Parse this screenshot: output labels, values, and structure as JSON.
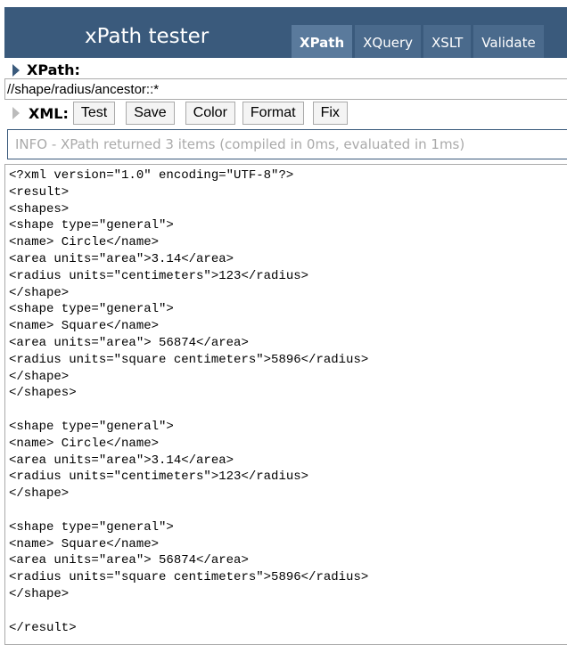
{
  "header": {
    "title": "xPath tester",
    "tabs": [
      {
        "label": "XPath",
        "active": true
      },
      {
        "label": "XQuery"
      },
      {
        "label": "XSLT"
      },
      {
        "label": "Validate"
      }
    ]
  },
  "xpath": {
    "label": "XPath:",
    "value": "//shape/radius/ancestor::*"
  },
  "xml": {
    "label": "XML:",
    "buttons": {
      "test": "Test",
      "save": "Save",
      "color": "Color",
      "format": "Format",
      "fix": "Fix"
    }
  },
  "info": "INFO - XPath returned 3 items (compiled in 0ms, evaluated in 1ms)",
  "result": "<?xml version=\"1.0\" encoding=\"UTF-8\"?>\n<result>\n<shapes>\n<shape type=\"general\">\n<name> Circle</name>\n<area units=\"area\">3.14</area>\n<radius units=\"centimeters\">123</radius>\n</shape>\n<shape type=\"general\">\n<name> Square</name>\n<area units=\"area\"> 56874</area>\n<radius units=\"square centimeters\">5896</radius>\n</shape>\n</shapes>\n\n<shape type=\"general\">\n<name> Circle</name>\n<area units=\"area\">3.14</area>\n<radius units=\"centimeters\">123</radius>\n</shape>\n\n<shape type=\"general\">\n<name> Square</name>\n<area units=\"area\"> 56874</area>\n<radius units=\"square centimeters\">5896</radius>\n</shape>\n\n</result>"
}
